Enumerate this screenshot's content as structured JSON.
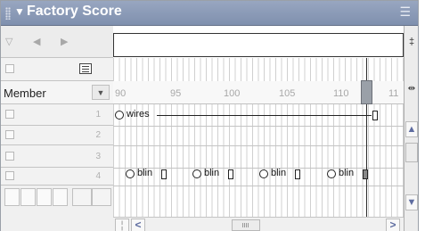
{
  "window": {
    "title": "Factory Score",
    "collapse_glyph": "▼",
    "menu_glyph": "☰"
  },
  "nav": {
    "filter_glyph": "▽",
    "prev_glyph": "◀",
    "next_glyph": "▶"
  },
  "member": {
    "label": "Member",
    "dropdown_glyph": "▼"
  },
  "ruler": {
    "ticks": [
      "90",
      "95",
      "100",
      "105",
      "110",
      "11"
    ]
  },
  "channels": [
    {
      "number": "1"
    },
    {
      "number": "2"
    },
    {
      "number": "3"
    },
    {
      "number": "4"
    }
  ],
  "sprites": {
    "wires": "wires",
    "blin": [
      "blin",
      "blin",
      "blin",
      "blin"
    ]
  },
  "right_panel": {
    "top_glyph": "‡",
    "zoom_glyph": "⇹",
    "up_glyph": "▲",
    "down_glyph": "▼"
  },
  "scrollbar": {
    "left_glyph": "<",
    "right_glyph": ">"
  },
  "icons": [
    "grip-icon",
    "collapse-arrow-icon",
    "options-menu-icon",
    "script-icon",
    "checkbox-icon",
    "zoom-icon"
  ],
  "colors": {
    "titlebar": "#8898b6",
    "playhead": "#9aa0a8",
    "scroll_arrow": "#5e6ca0"
  }
}
